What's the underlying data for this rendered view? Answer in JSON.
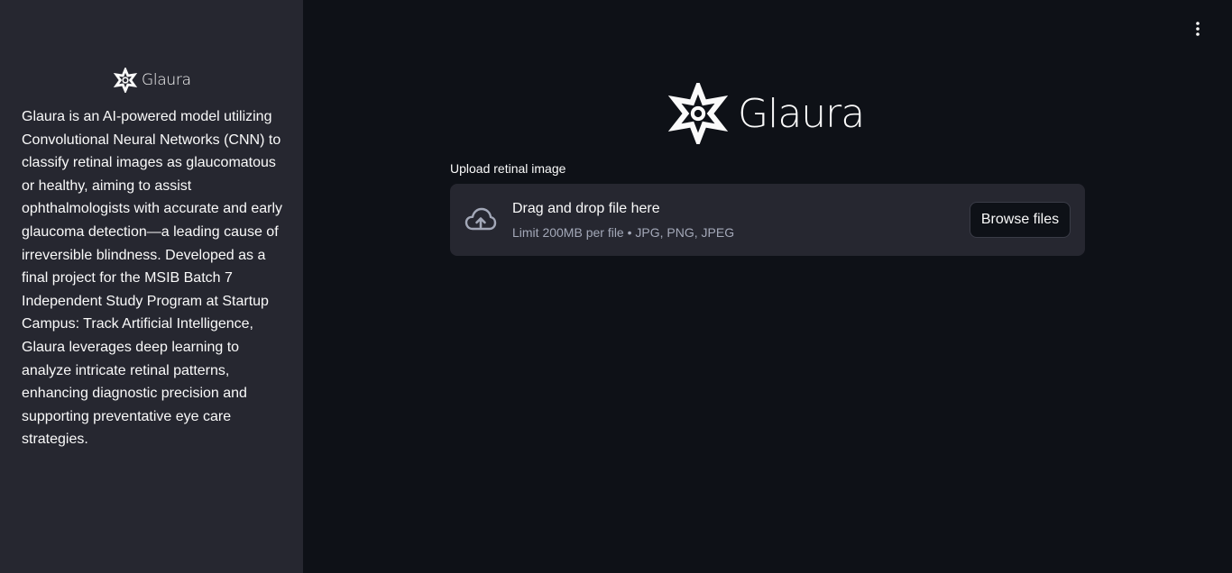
{
  "sidebar": {
    "logo_text": "Glaura",
    "description": "Glaura is an AI-powered model utilizing Convolutional Neural Networks (CNN) to classify retinal images as glaucomatous or healthy, aiming to assist ophthalmologists with accurate and early glaucoma detection—a leading cause of irreversible blindness. Developed as a final project for the MSIB Batch 7 Independent Study Program at Startup Campus: Track Artificial Intelligence, Glaura leverages deep learning to analyze intricate retinal patterns, enhancing diagnostic precision and supporting preventative eye care strategies."
  },
  "header": {
    "menu_icon": "vertical-dots-icon"
  },
  "main": {
    "logo_text": "Glaura",
    "uploader": {
      "label": "Upload retinal image",
      "title": "Drag and drop file here",
      "subtitle": "Limit 200MB per file • JPG, PNG, JPEG",
      "button": "Browse files",
      "icon": "cloud-upload-icon"
    }
  },
  "colors": {
    "background": "#0e1117",
    "sidebar": "#262730",
    "dropzone": "#262730",
    "text": "#fafafa",
    "muted_text": "#a3a8b8"
  }
}
